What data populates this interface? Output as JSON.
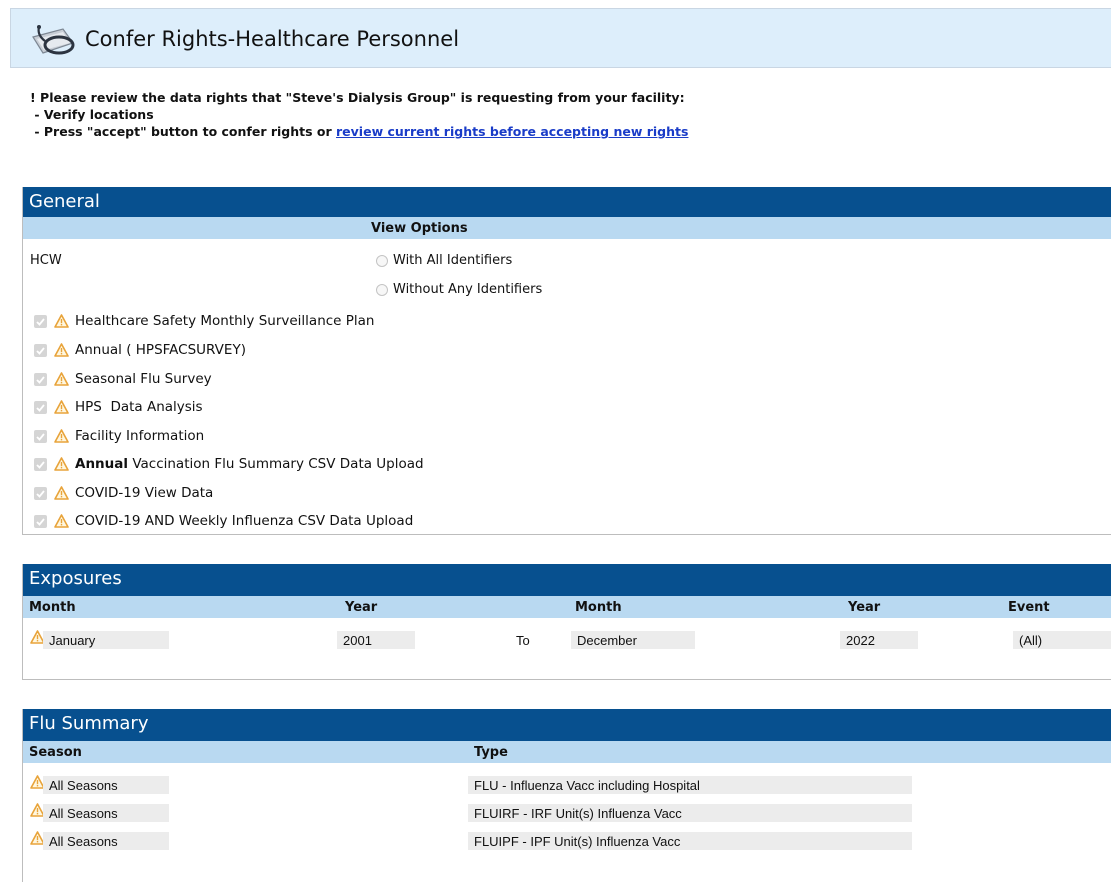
{
  "page": {
    "title": "Confer Rights-Healthcare Personnel",
    "title_icon": "stethoscope-icon"
  },
  "instructions": {
    "line1": "! Please review the data rights that \"Steve's Dialysis Group\" is requesting from your facility:",
    "line2": " - Verify locations",
    "line3_prefix": " - Press \"accept\" button to confer rights or ",
    "line3_link": "review current rights before accepting new rights"
  },
  "general": {
    "header": "General",
    "view_options_label": "View Options",
    "hcw_label": "HCW",
    "radio_all": "With All Identifiers",
    "radio_none": "Without Any Identifiers",
    "items": [
      {
        "bold": "",
        "label": "Healthcare Safety Monthly Surveillance Plan"
      },
      {
        "bold": "",
        "label": "Annual ( HPSFACSURVEY)"
      },
      {
        "bold": "",
        "label": "Seasonal Flu Survey"
      },
      {
        "bold": "",
        "label": "HPS  Data Analysis"
      },
      {
        "bold": "",
        "label": "Facility Information"
      },
      {
        "bold": "Annual",
        "label": " Vaccination Flu Summary CSV Data Upload"
      },
      {
        "bold": "",
        "label": "COVID-19 View Data"
      },
      {
        "bold": "",
        "label": "COVID-19 AND Weekly Influenza CSV Data Upload"
      }
    ]
  },
  "exposures": {
    "header": "Exposures",
    "columns": [
      "Month",
      "Year",
      "Month",
      "Year",
      "Event"
    ],
    "row": {
      "from_month": "January",
      "from_year": "2001",
      "to_label": "To",
      "to_month": "December",
      "to_year": "2022",
      "event": "(All)"
    }
  },
  "flu_summary": {
    "header": "Flu Summary",
    "columns": [
      "Season",
      "Type"
    ],
    "rows": [
      {
        "season": "All Seasons",
        "type": "FLU - Influenza Vacc including Hospital"
      },
      {
        "season": "All Seasons",
        "type": "FLUIRF - IRF Unit(s) Influenza Vacc"
      },
      {
        "season": "All Seasons",
        "type": "FLUIPF - IPF Unit(s) Influenza Vacc"
      }
    ]
  },
  "colors": {
    "section_header": "#07508f",
    "sub_header": "#b9d9f1",
    "title_bar": "#ddeefb",
    "warning": "#e8a33a",
    "link": "#1a3cc8"
  }
}
